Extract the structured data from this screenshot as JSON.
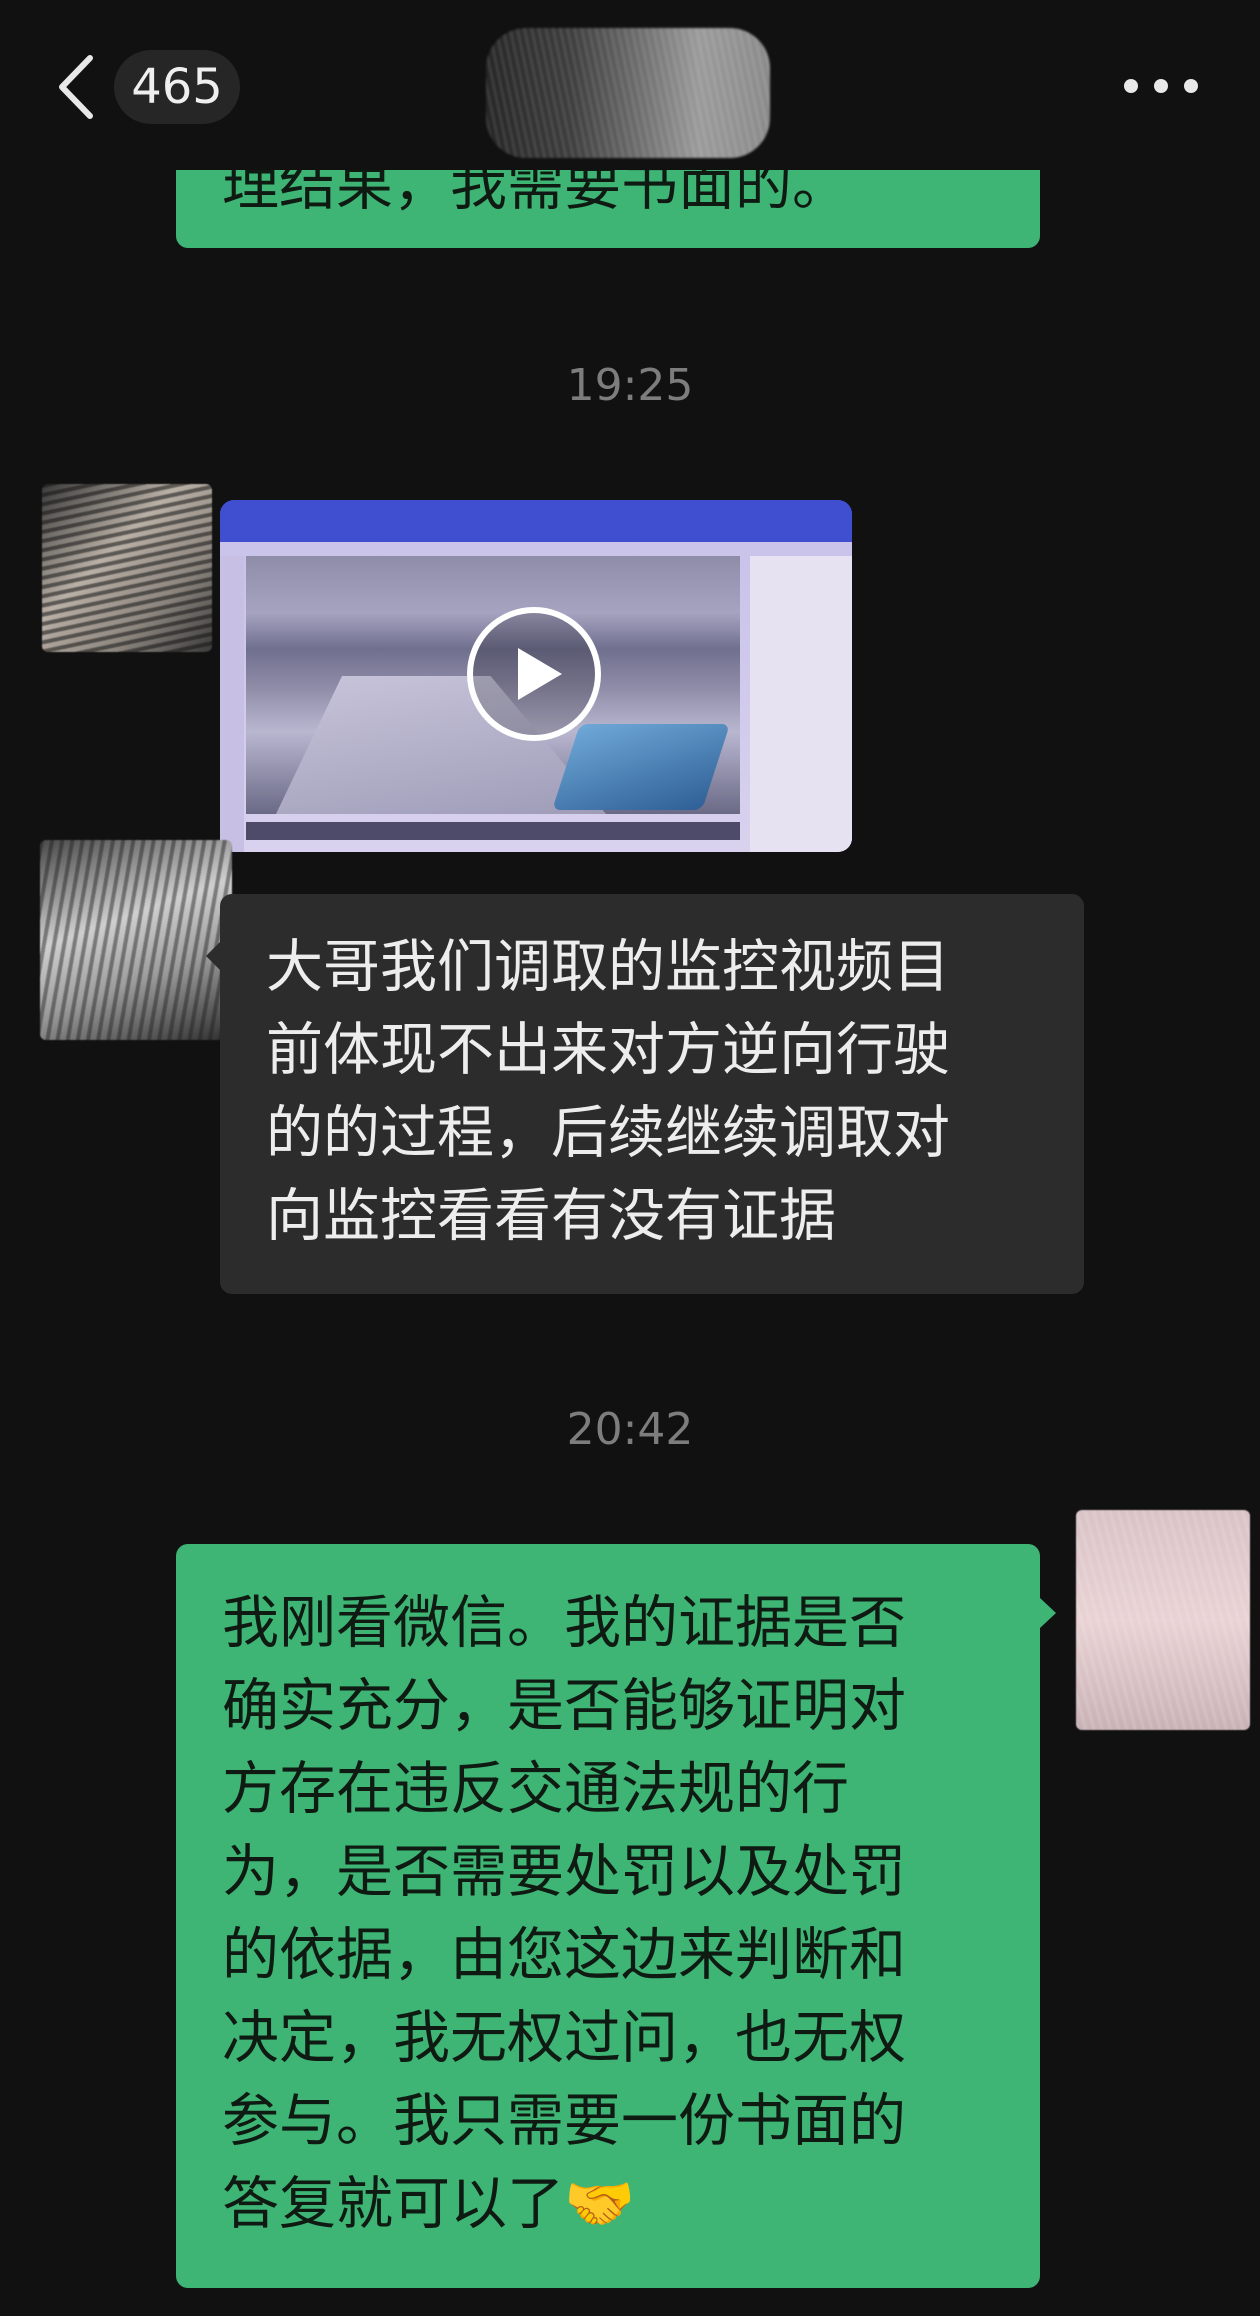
{
  "header": {
    "unread_count": "465",
    "back_icon": "chevron-left-icon",
    "more_icon": "more-dots-icon"
  },
  "messages": [
    {
      "kind": "text",
      "sender": "self",
      "text": "理结果，我需要书面的。"
    },
    {
      "kind": "timestamp",
      "time": "19:25"
    },
    {
      "kind": "video",
      "sender": "peer",
      "play_icon": "play-icon"
    },
    {
      "kind": "text",
      "sender": "peer",
      "text": "大哥我们调取的监控视频目\n前体现不出来对方逆向行驶\n的的过程，后续继续调取对\n向监控看看有没有证据"
    },
    {
      "kind": "timestamp",
      "time": "20:42"
    },
    {
      "kind": "text",
      "sender": "self",
      "text": "我刚看微信。我的证据是否\n确实充分，是否能够证明对\n方存在违反交通法规的行\n为，是否需要处罚以及处罚\n的依据，由您这边来判断和\n决定，我无权过问，也无权\n参与。我只需要一份书面的\n答复就可以了🤝"
    }
  ],
  "colors": {
    "background": "#111111",
    "self_bubble": "#3eb575",
    "peer_bubble": "#2c2c2c",
    "timestamp_text": "#7d7d7d"
  }
}
